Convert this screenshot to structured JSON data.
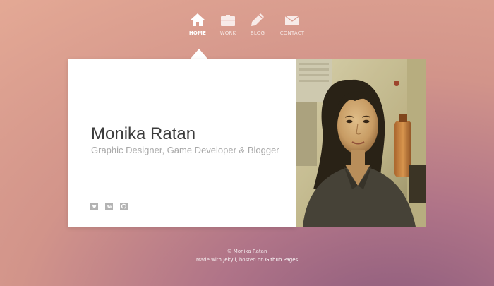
{
  "nav": {
    "items": [
      {
        "label": "HOME",
        "icon": "home-icon",
        "active": true
      },
      {
        "label": "WORK",
        "icon": "briefcase-icon",
        "active": false
      },
      {
        "label": "BLOG",
        "icon": "pencil-icon",
        "active": false
      },
      {
        "label": "CONTACT",
        "icon": "envelope-icon",
        "active": false
      }
    ]
  },
  "profile": {
    "name": "Monika Ratan",
    "tagline": "Graphic Designer, Game Developer & Blogger",
    "social": [
      "twitter-icon",
      "behance-icon",
      "github-icon"
    ],
    "photo_icon": "profile-photo"
  },
  "footer": {
    "copyright": "© Monika Ratan",
    "made_with": "Made with",
    "jekyll": "Jekyll",
    "hosted_on": ", hosted on",
    "github_pages": "Github Pages"
  },
  "colors": {
    "background_top": "#e4a995",
    "background_bottom": "#8a5a7c",
    "card": "#ffffff",
    "name": "#3c3c3c",
    "tagline": "#a8a8a8"
  }
}
